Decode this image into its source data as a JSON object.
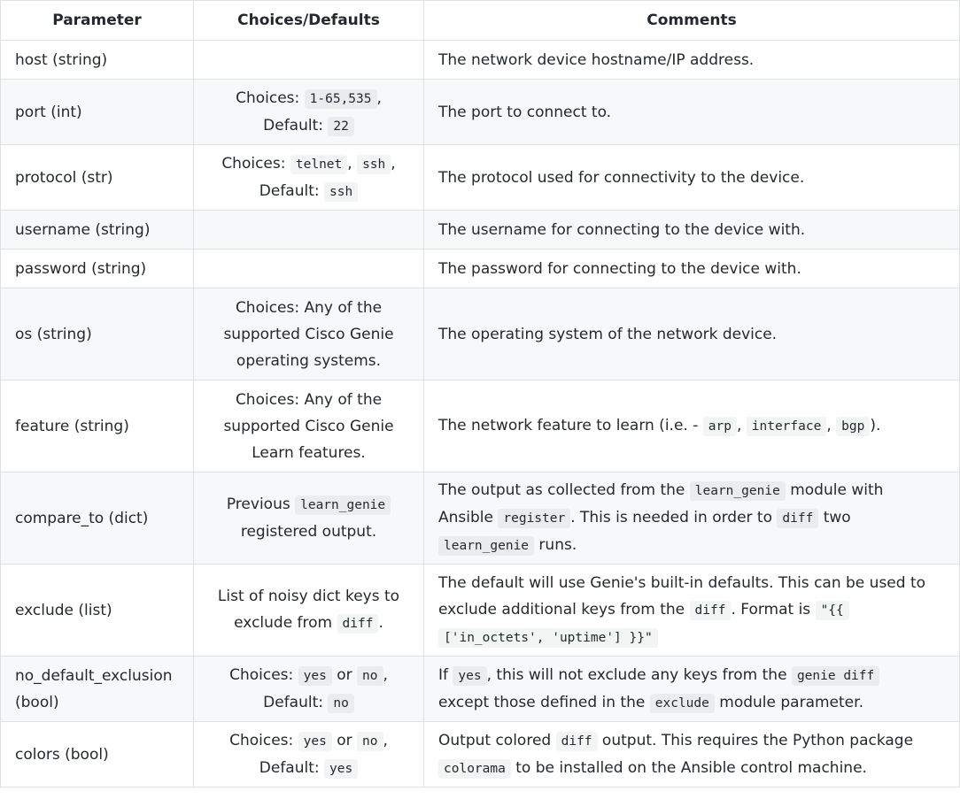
{
  "headers": [
    "Parameter",
    "Choices/Defaults",
    "Comments"
  ],
  "rows": [
    {
      "param": "host (string)",
      "choices": [],
      "comments": [
        {
          "t": "The network device hostname/IP address."
        }
      ]
    },
    {
      "param": "port (int)",
      "choices": [
        {
          "t": "Choices: "
        },
        {
          "c": "1-65,535"
        },
        {
          "t": ","
        },
        {
          "br": true
        },
        {
          "t": "Default: "
        },
        {
          "c": "22"
        }
      ],
      "comments": [
        {
          "t": "The port to connect to."
        }
      ]
    },
    {
      "param": "protocol (str)",
      "choices": [
        {
          "t": "Choices: "
        },
        {
          "c": "telnet"
        },
        {
          "t": ", "
        },
        {
          "c": "ssh"
        },
        {
          "t": ","
        },
        {
          "br": true
        },
        {
          "t": "Default: "
        },
        {
          "c": "ssh"
        }
      ],
      "comments": [
        {
          "t": "The protocol used for connectivity to the device."
        }
      ]
    },
    {
      "param": "username (string)",
      "choices": [],
      "comments": [
        {
          "t": "The username for connecting to the device with."
        }
      ]
    },
    {
      "param": "password (string)",
      "choices": [],
      "comments": [
        {
          "t": "The password for connecting to the device with."
        }
      ]
    },
    {
      "param": "os (string)",
      "choices": [
        {
          "t": "Choices: Any of the"
        },
        {
          "br": true
        },
        {
          "t": "supported Cisco Genie"
        },
        {
          "br": true
        },
        {
          "t": "operating systems."
        }
      ],
      "comments": [
        {
          "t": "The operating system of the network device."
        }
      ]
    },
    {
      "param": "feature (string)",
      "choices": [
        {
          "t": "Choices: Any of the"
        },
        {
          "br": true
        },
        {
          "t": "supported Cisco Genie"
        },
        {
          "br": true
        },
        {
          "t": "Learn features."
        }
      ],
      "comments": [
        {
          "t": "The network feature to learn (i.e. - "
        },
        {
          "c": "arp"
        },
        {
          "t": ", "
        },
        {
          "c": "interface"
        },
        {
          "t": ", "
        },
        {
          "c": "bgp"
        },
        {
          "t": ")."
        }
      ]
    },
    {
      "param": "compare_to (dict)",
      "choices": [
        {
          "t": "Previous "
        },
        {
          "c": "learn_genie"
        },
        {
          "br": true
        },
        {
          "t": "registered output."
        }
      ],
      "comments": [
        {
          "t": "The output as collected from the "
        },
        {
          "c": "learn_genie"
        },
        {
          "t": " module with"
        },
        {
          "br": true
        },
        {
          "t": "Ansible "
        },
        {
          "c": "register"
        },
        {
          "t": ". This is needed in order to "
        },
        {
          "c": "diff"
        },
        {
          "t": " two"
        },
        {
          "br": true
        },
        {
          "c": "learn_genie"
        },
        {
          "t": " runs."
        }
      ]
    },
    {
      "param": "exclude (list)",
      "choices": [
        {
          "t": "List of noisy dict keys to"
        },
        {
          "br": true
        },
        {
          "t": "exclude from "
        },
        {
          "c": "diff"
        },
        {
          "t": "."
        }
      ],
      "comments": [
        {
          "t": "The default will use Genie's built-in defaults. This can be used to"
        },
        {
          "br": true
        },
        {
          "t": "exclude additional keys from the "
        },
        {
          "c": "diff"
        },
        {
          "t": ". Format is "
        },
        {
          "c": "\"{{"
        },
        {
          "br": true
        },
        {
          "c": "['in_octets', 'uptime'] }}\""
        }
      ]
    },
    {
      "param": "no_default_exclusion (bool)",
      "choices": [
        {
          "t": "Choices: "
        },
        {
          "c": "yes"
        },
        {
          "t": " or "
        },
        {
          "c": "no"
        },
        {
          "t": ","
        },
        {
          "br": true
        },
        {
          "t": "Default: "
        },
        {
          "c": "no"
        }
      ],
      "comments": [
        {
          "t": "If "
        },
        {
          "c": "yes"
        },
        {
          "t": ", this will not exclude any keys from the "
        },
        {
          "c": "genie diff"
        },
        {
          "br": true
        },
        {
          "t": "except those defined in the "
        },
        {
          "c": "exclude"
        },
        {
          "t": " module parameter."
        }
      ]
    },
    {
      "param": "colors (bool)",
      "choices": [
        {
          "t": "Choices: "
        },
        {
          "c": "yes"
        },
        {
          "t": " or "
        },
        {
          "c": "no"
        },
        {
          "t": ","
        },
        {
          "br": true
        },
        {
          "t": "Default: "
        },
        {
          "c": "yes"
        }
      ],
      "comments": [
        {
          "t": "Output colored "
        },
        {
          "c": "diff"
        },
        {
          "t": " output. This requires the Python package"
        },
        {
          "br": true
        },
        {
          "c": "colorama"
        },
        {
          "t": " to be installed on the Ansible control machine."
        }
      ]
    }
  ]
}
